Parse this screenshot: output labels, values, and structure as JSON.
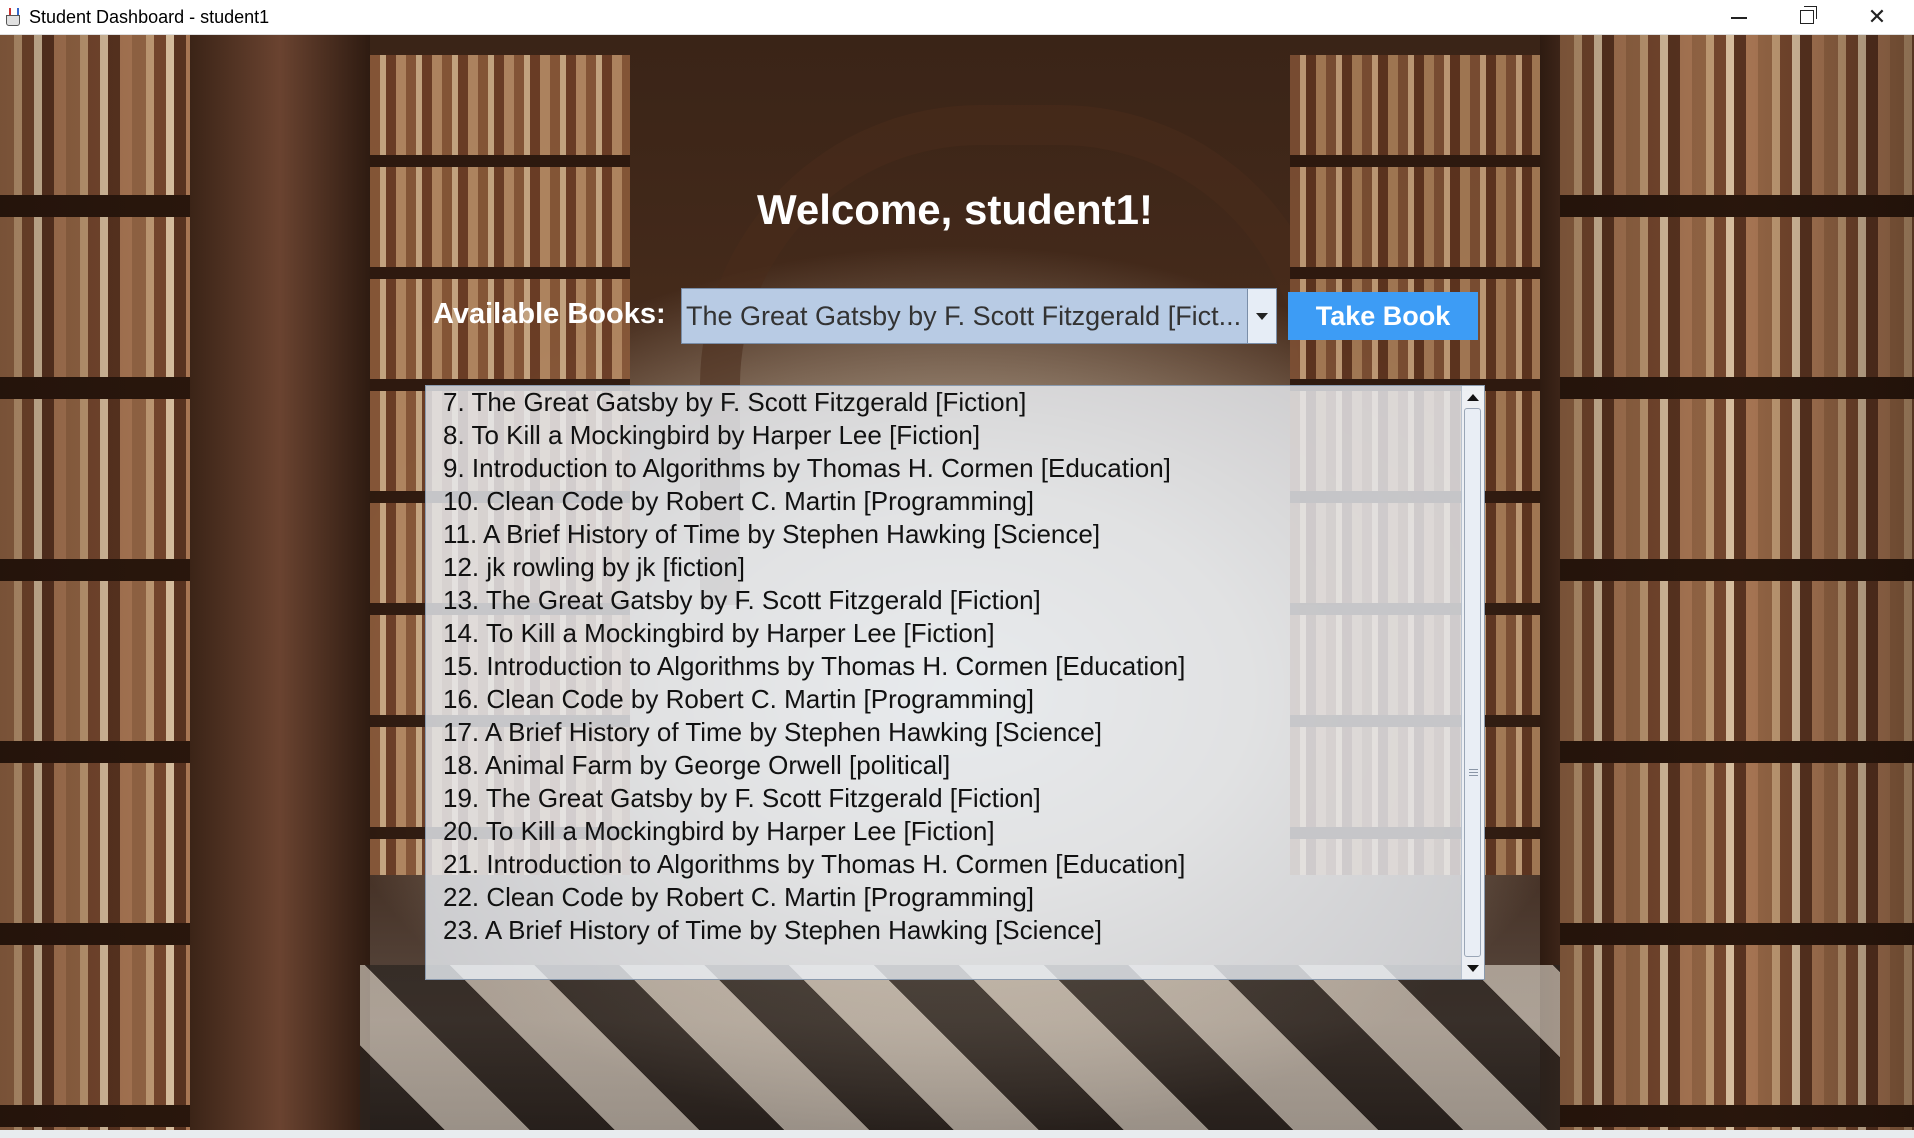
{
  "window": {
    "title": "Student Dashboard - student1",
    "controls": [
      "minimize",
      "restore",
      "close"
    ]
  },
  "welcome": "Welcome, student1!",
  "books_selector": {
    "label": "Available Books:",
    "selected": "The Great Gatsby by F. Scott Fitzgerald [Fict..."
  },
  "take_button": "Take Book",
  "book_list": [
    "7. The Great Gatsby by F. Scott Fitzgerald [Fiction]",
    "8. To Kill a Mockingbird by Harper Lee [Fiction]",
    "9. Introduction to Algorithms by Thomas H. Cormen [Education]",
    "10. Clean Code by Robert C. Martin [Programming]",
    "11. A Brief History of Time by Stephen Hawking [Science]",
    "12. jk rowling by jk [fiction]",
    "13. The Great Gatsby by F. Scott Fitzgerald [Fiction]",
    "14. To Kill a Mockingbird by Harper Lee [Fiction]",
    "15. Introduction to Algorithms by Thomas H. Cormen [Education]",
    "16. Clean Code by Robert C. Martin [Programming]",
    "17. A Brief History of Time by Stephen Hawking [Science]",
    "18. Animal Farm by George Orwell [political]",
    "19. The Great Gatsby by F. Scott Fitzgerald [Fiction]",
    "20. To Kill a Mockingbird by Harper Lee [Fiction]",
    "21. Introduction to Algorithms by Thomas H. Cormen [Education]",
    "22. Clean Code by Robert C. Martin [Programming]",
    "23. A Brief History of Time by Stephen Hawking [Science]"
  ],
  "colors": {
    "button": "#3d9cf5",
    "combo": "#b8cbe4",
    "text_light": "#ffffff"
  }
}
